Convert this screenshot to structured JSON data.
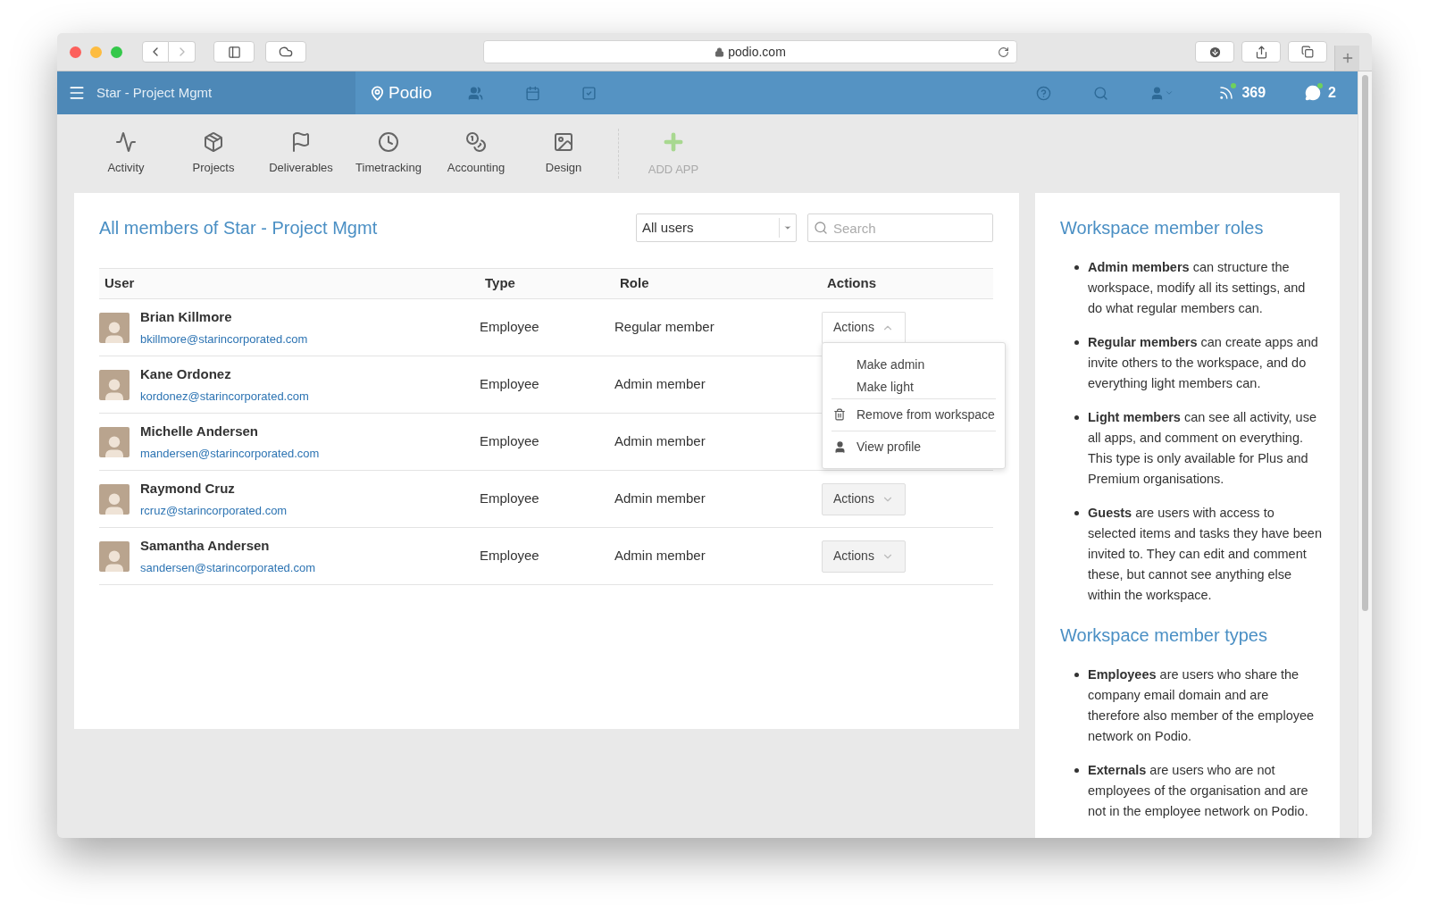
{
  "browser": {
    "url": "podio.com"
  },
  "topbar": {
    "workspace": "Star - Project Mgmt",
    "brand": "Podio",
    "counters": [
      {
        "kind": "activity",
        "count": "369"
      },
      {
        "kind": "chat",
        "count": "2"
      }
    ]
  },
  "apps": [
    {
      "kind": "activity",
      "label": "Activity"
    },
    {
      "kind": "projects",
      "label": "Projects"
    },
    {
      "kind": "deliverables",
      "label": "Deliverables"
    },
    {
      "kind": "timetracking",
      "label": "Timetracking"
    },
    {
      "kind": "accounting",
      "label": "Accounting"
    },
    {
      "kind": "design",
      "label": "Design"
    },
    {
      "kind": "add",
      "label": "ADD APP"
    }
  ],
  "members": {
    "title": "All members of Star - Project Mgmt",
    "filter": {
      "value": "All users"
    },
    "search": {
      "placeholder": "Search"
    },
    "columns": [
      "User",
      "Type",
      "Role",
      "Actions"
    ],
    "rows": [
      {
        "name": "Brian Killmore",
        "email": "bkillmore@starincorporated.com",
        "type": "Employee",
        "role": "Regular member",
        "actions": {
          "label": "Actions",
          "expanded": true,
          "menu": [
            {
              "kind": "plain",
              "label": "Make admin"
            },
            {
              "kind": "plain",
              "label": "Make light"
            },
            {
              "kind": "remove",
              "label": "Remove from workspace"
            },
            {
              "kind": "profile",
              "label": "View profile"
            }
          ]
        }
      },
      {
        "name": "Kane Ordonez",
        "email": "kordonez@starincorporated.com",
        "type": "Employee",
        "role": "Admin member"
      },
      {
        "name": "Michelle Andersen",
        "email": "mandersen@starincorporated.com",
        "type": "Employee",
        "role": "Admin member"
      },
      {
        "name": "Raymond Cruz",
        "email": "rcruz@starincorporated.com",
        "type": "Employee",
        "role": "Admin member",
        "actions": {
          "label": "Actions",
          "expanded": false
        }
      },
      {
        "name": "Samantha Andersen",
        "email": "sandersen@starincorporated.com",
        "type": "Employee",
        "role": "Admin member",
        "actions": {
          "label": "Actions",
          "expanded": false
        }
      }
    ]
  },
  "help": {
    "sections": [
      {
        "title": "Workspace member roles",
        "items": [
          "**Admin members** can structure the workspace, modify all its settings, and do what regular members can.",
          "**Regular members** can create apps and invite others to the workspace, and do everything light members can.",
          "**Light members** can see all activity, use all apps, and comment on everything. This type is only available for Plus and Premium organisations.",
          "**Guests** are users with access to selected items and tasks they have been invited to. They can edit and comment these, but cannot see anything else within the workspace."
        ]
      },
      {
        "title": "Workspace member types",
        "items": [
          "**Employees** are users who share the company email domain and are therefore also member of the employee network on Podio.",
          "**Externals** are users who are not employees of the organisation and are not in the employee network on Podio."
        ]
      }
    ]
  }
}
